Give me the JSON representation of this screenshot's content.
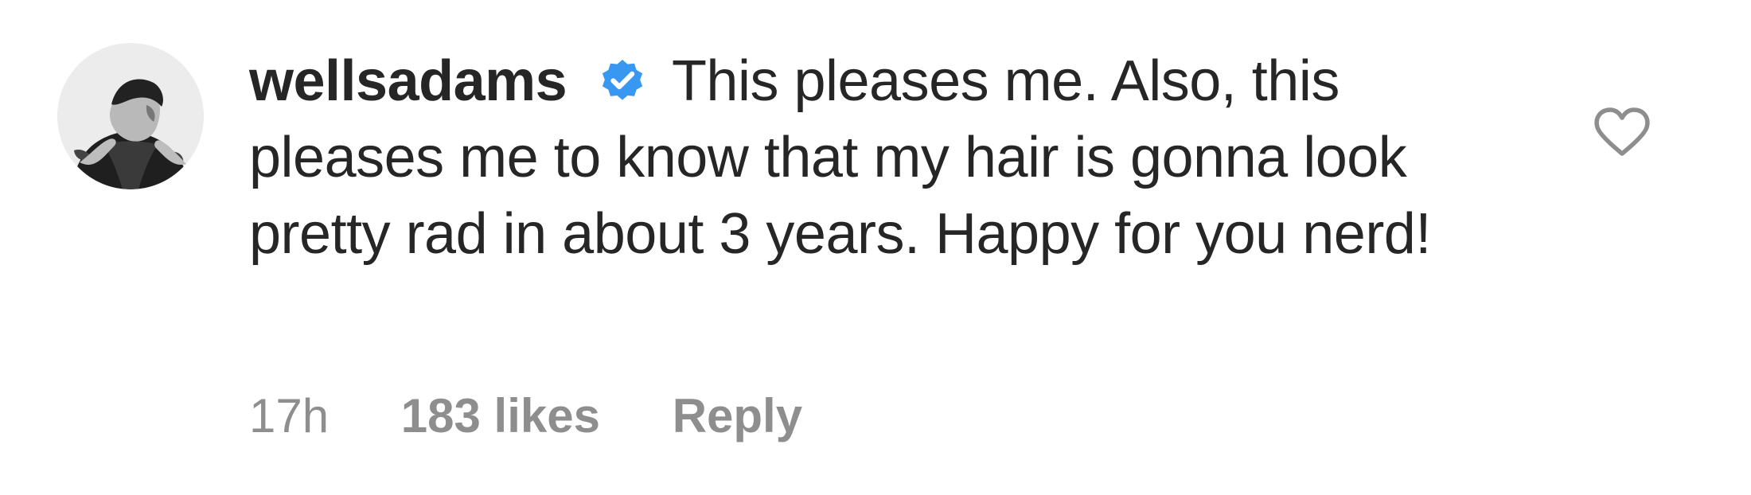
{
  "comment": {
    "username": "wellsadams",
    "verified_icon": "verified-badge-icon",
    "text": "This pleases me. Also, this pleases me to know that my hair is gonna look pretty rad in about 3 years. Happy for you nerd!",
    "time": "17h",
    "likes": "183 likes",
    "reply_label": "Reply",
    "like_icon": "heart-outline-icon",
    "avatar_icon": "profile-photo"
  },
  "colors": {
    "text": "#262626",
    "muted": "#8e8e8e",
    "verified_blue": "#3897f0",
    "background": "#ffffff"
  }
}
